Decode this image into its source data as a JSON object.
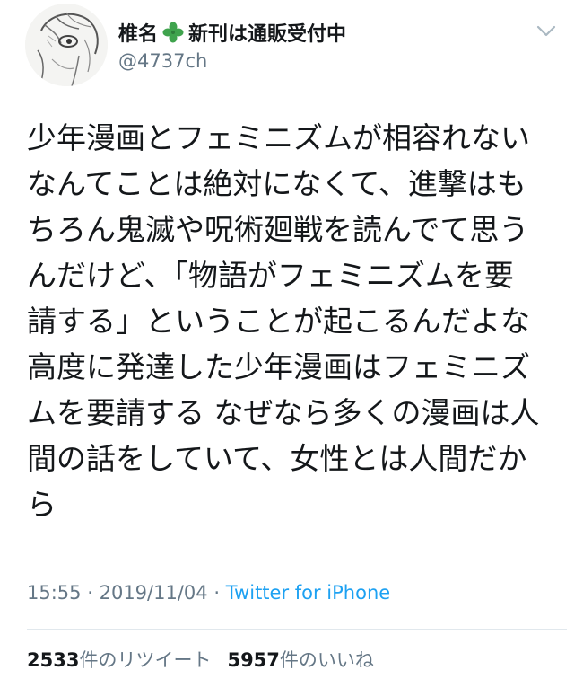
{
  "header": {
    "display_name": "椎名",
    "name_emoji": "four-leaf-clover-icon",
    "name_suffix": "新刊は通販受付中",
    "handle": "@4737ch"
  },
  "tweet": {
    "lines": [
      "少年漫画とフェミニズムが相容れない",
      "なんてことは絶対になくて、進撃はも",
      "ちろん鬼滅や呪術廻戦を読んでて思う",
      "んだけど、「物語がフェミニズムを要",
      "請する」ということが起こるんだよな",
      "高度に発達した少年漫画はフェミニズ",
      "ムを要請する なぜなら多くの漫画は人",
      "間の話をしていて、女性とは人間だか",
      "ら"
    ]
  },
  "meta": {
    "time": "15:55",
    "separator": "·",
    "date": "2019/11/04",
    "source": "Twitter for iPhone"
  },
  "stats": {
    "retweets_count": "2533",
    "retweets_label": "件のリツイート",
    "likes_count": "5957",
    "likes_label": "件のいいね"
  },
  "colors": {
    "text": "#14171a",
    "secondary": "#657786",
    "link": "#1da1f2",
    "divider": "#e1e8ed",
    "clover": "#3fa34d"
  }
}
